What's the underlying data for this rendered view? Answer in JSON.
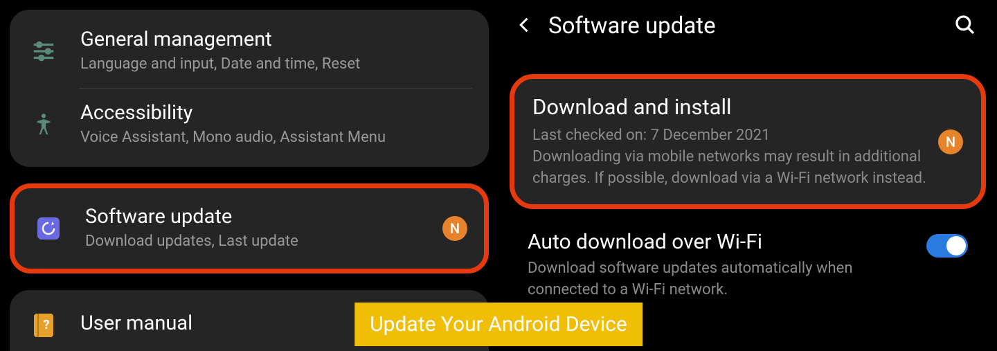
{
  "left": {
    "items": [
      {
        "title": "General management",
        "subtitle": "Language and input, Date and time, Reset"
      },
      {
        "title": "Accessibility",
        "subtitle": "Voice Assistant, Mono audio, Assistant Menu"
      }
    ],
    "highlighted": {
      "title": "Software update",
      "subtitle": "Download updates, Last update",
      "badge": "N"
    },
    "manual": {
      "title": "User manual"
    }
  },
  "right": {
    "header": {
      "title": "Software update"
    },
    "download": {
      "title": "Download and install",
      "subtitle": "Last checked on: 7 December 2021\nDownloading via mobile networks may result in additional charges. If possible, download via a Wi-Fi network instead.",
      "badge": "N"
    },
    "auto": {
      "title": "Auto download over Wi-Fi",
      "subtitle": "Download software updates automatically when connected to a Wi-Fi network."
    }
  },
  "caption": "Update Your Android Device"
}
